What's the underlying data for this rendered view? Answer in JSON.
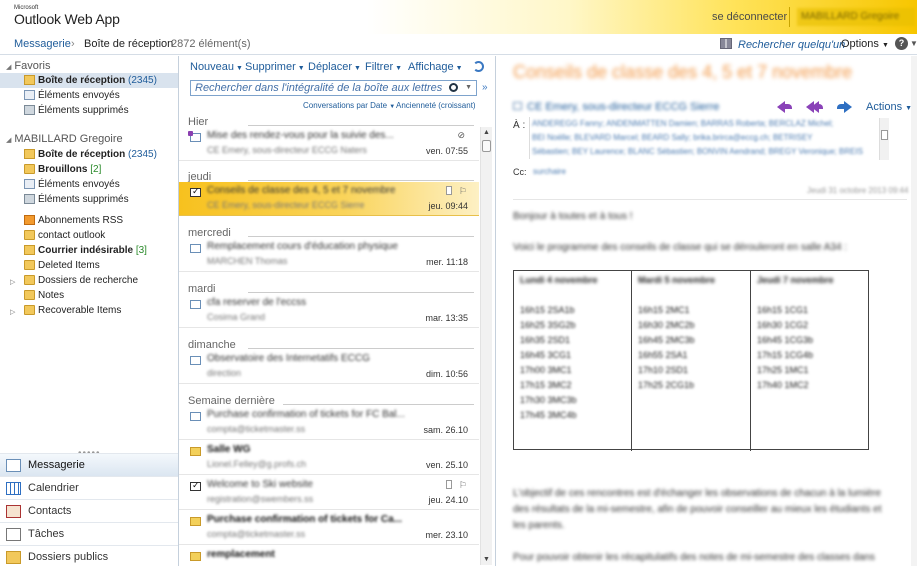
{
  "app": {
    "brand": "Microsoft",
    "name": "Outlook Web App",
    "signout": "se déconnecter",
    "user": "MABILLARD Gregoire"
  },
  "crumb": {
    "module": "Messagerie",
    "sep": "›",
    "folder": "Boîte de réception",
    "count": "2872 élément(s)"
  },
  "top": {
    "find_people": "Rechercher quelqu'un",
    "options": "Options",
    "help": "?"
  },
  "nav": {
    "favorites_label": "Favoris",
    "favorites": [
      {
        "label": "Boîte de réception",
        "count": "(2345)"
      },
      {
        "label": "Éléments envoyés",
        "count": ""
      },
      {
        "label": "Éléments supprimés",
        "count": ""
      }
    ],
    "mailbox_label": "MABILLARD Gregoire",
    "mailbox": [
      {
        "label": "Boîte de réception",
        "count": "(2345)"
      },
      {
        "label": "Brouillons",
        "count": "[2]"
      },
      {
        "label": "Éléments envoyés",
        "count": ""
      },
      {
        "label": "Éléments supprimés",
        "count": ""
      },
      {
        "label": "Abonnements RSS",
        "count": ""
      },
      {
        "label": "contact outlook",
        "count": ""
      },
      {
        "label": "Courrier indésirable",
        "count": "[3]"
      },
      {
        "label": "Deleted Items",
        "count": ""
      },
      {
        "label": "Dossiers de recherche",
        "count": ""
      },
      {
        "label": "Notes",
        "count": ""
      },
      {
        "label": "Recoverable Items",
        "count": ""
      }
    ],
    "modules": [
      "Messagerie",
      "Calendrier",
      "Contacts",
      "Tâches",
      "Dossiers publics"
    ]
  },
  "toolbar": {
    "new": "Nouveau",
    "delete": "Supprimer",
    "move": "Déplacer",
    "filter": "Filtrer",
    "view": "Affichage"
  },
  "search": {
    "placeholder": "Rechercher dans l'intégralité de la boîte aux lettres"
  },
  "sort": {
    "by": "Conversations par Date",
    "order": "Ancienneté (croissant)"
  },
  "groups": [
    "Hier",
    "jeudi",
    "mercredi",
    "mardi",
    "dimanche",
    "Semaine dernière"
  ],
  "messages": [
    {
      "subject": "Mise des rendez-vous pour la suivie des...",
      "from": "CE Emery, sous-directeur ECCG Naters",
      "date": "ven. 07:55"
    },
    {
      "subject": "Conseils de classe des 4, 5 et 7 novembre",
      "from": "CE Emery, sous-directeur ECCG Sierre",
      "date": "jeu. 09:44"
    },
    {
      "subject": "Remplacement cours d'éducation physique",
      "from": "MARCHEN Thomas",
      "date": "mer. 11:18"
    },
    {
      "subject": "cfa reserver de l'eccss",
      "from": "Cosima Grand",
      "date": "mar. 13:35"
    },
    {
      "subject": "Observatoire des Internetatifs ECCG",
      "from": "direction",
      "date": "dim. 10:56"
    },
    {
      "subject": "Purchase confirmation of tickets for FC Bal...",
      "from": "compta@ticketmaster.ss",
      "date": "sam. 26.10"
    },
    {
      "subject": "Salle WG",
      "from": "Lionel.Felley@g.profs.ch",
      "date": "ven. 25.10"
    },
    {
      "subject": "Welcome to Ski website",
      "from": "registration@swembers.ss",
      "date": "jeu. 24.10"
    },
    {
      "subject": "Purchase confirmation of tickets for Ca...",
      "from": "compta@ticketmaster.ss",
      "date": "mer. 23.10"
    },
    {
      "subject": "remplacement",
      "from": "",
      "date": ""
    }
  ],
  "reading": {
    "subject": "Conseils de classe des 4, 5 et 7 novembre",
    "sender": "CE Emery, sous-directeur ECCG Sierre",
    "actions": "Actions",
    "to_label": "À :",
    "to_lines": [
      "ANDEREGG Fanny; ANDENMATTEN Damien; BARRAS Roberta; BERCLAZ Michel;",
      "BEI Noëlle; BLEVARD Marcel; BEARD Sally; brika.brirca@eccg.ch; BETRISEY",
      "Sébastien; BEY Laurence; BLANC Sébastien; BONVIN Aendrand; BREGY Veronique; BREIS"
    ],
    "cc_label": "Cc:",
    "cc_value": "surchaire",
    "sent": "Jeudi 31 octobre 2013 09:44",
    "greeting": "Bonjour à toutes et à tous !",
    "intro": "Voici le programme des conseils de classe qui se dérouleront en salle A34 :",
    "table": [
      {
        "head": "Lundi 4 novembre",
        "rows": [
          "16h15  2SA1b",
          "16h25  3SG2b",
          "16h35  2SD1",
          "16h45  3CG1",
          "17h00  3MC1",
          "17h15  3MC2",
          "17h30  3MC3b",
          "17h45  3MC4b"
        ]
      },
      {
        "head": "Mardi 5 novembre",
        "rows": [
          "16h15  2MC1",
          "16h30  2MC2b",
          "16h45  2MC3b",
          "16h55  2SA1",
          "17h10  2SD1",
          "17h25  2CG1b"
        ]
      },
      {
        "head": "Jeudi 7 novembre",
        "rows": [
          "16h15  1CG1",
          "16h30  1CG2",
          "16h45  1CG3b",
          "17h15  1CG4b",
          "17h25  1MC1",
          "17h40  1MC2"
        ]
      }
    ],
    "para1": "L'objectif de ces rencontres est d'échanger les observations de chacun à la lumière des résultats de la mi-semestre, afin de pouvoir conseiller au mieux les étudiants et les parents.",
    "para2": "Pour pouvoir obtenir les récapitulatifs des notes de mi-semestre des classes dans"
  }
}
